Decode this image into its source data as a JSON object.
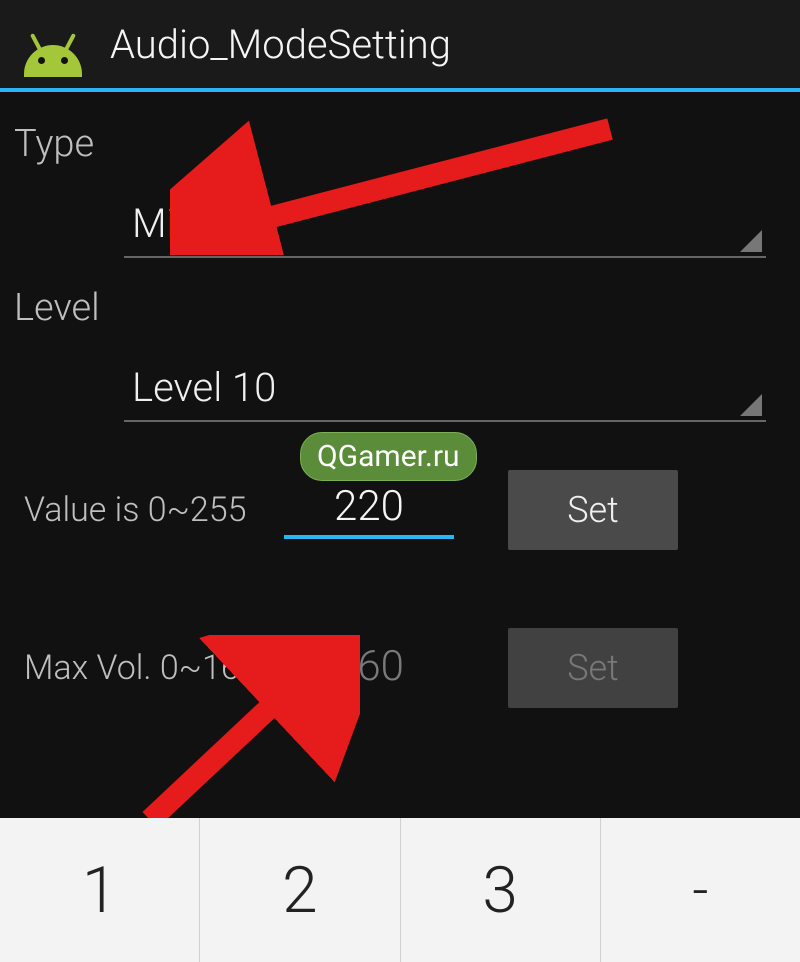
{
  "header": {
    "title": "Audio_ModeSetting"
  },
  "type": {
    "label": "Type",
    "value": "Mic"
  },
  "level": {
    "label": "Level",
    "value": "Level 10"
  },
  "value": {
    "label": "Value is 0~255",
    "input": "220",
    "button": "Set"
  },
  "maxvol": {
    "label": "Max Vol. 0~160",
    "input": "160",
    "button": "Set"
  },
  "watermark": "QGamer.ru",
  "keyboard": {
    "k1": "1",
    "k2": "2",
    "k3": "3",
    "k4": "-"
  }
}
